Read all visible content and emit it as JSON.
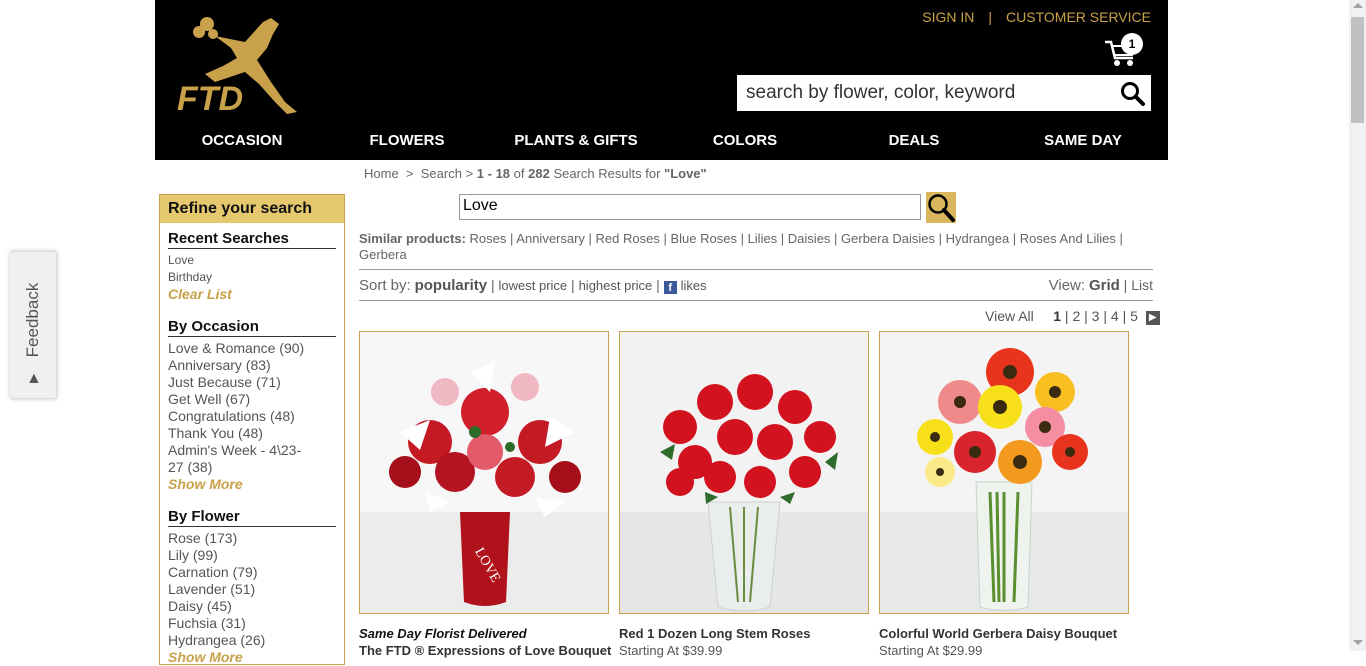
{
  "header": {
    "logo_text": "FTD",
    "sign_in": "SIGN IN",
    "separator": "|",
    "customer_service": "CUSTOMER SERVICE",
    "cart_count": "1",
    "search_placeholder": "search by flower, color, keyword",
    "nav": [
      "OCCASION",
      "FLOWERS",
      "PLANTS & GIFTS",
      "COLORS",
      "DEALS",
      "SAME DAY"
    ]
  },
  "feedback": {
    "label": "Feedback",
    "arrow": "▲"
  },
  "breadcrumb": {
    "home": "Home",
    "sep": ">",
    "search": "Search",
    "range": "1 - 18",
    "of": "of",
    "total": "282",
    "label": "Search Results for",
    "query": "\"Love\""
  },
  "sidebar": {
    "refine_title": "Refine your search",
    "recent": {
      "title": "Recent Searches",
      "items": [
        "Love",
        "Birthday"
      ],
      "clear": "Clear List"
    },
    "occasion": {
      "title": "By Occasion",
      "items": [
        "Love & Romance (90)",
        "Anniversary (83)",
        "Just Because (71)",
        "Get Well (67)",
        "Congratulations (48)",
        "Thank You (48)",
        "Admin's Week - 4\\23-",
        "27 (38)"
      ],
      "more": "Show More"
    },
    "flower": {
      "title": "By Flower",
      "items": [
        "Rose (173)",
        "Lily (99)",
        "Carnation (79)",
        "Lavender (51)",
        "Daisy (45)",
        "Fuchsia (31)",
        "Hydrangea (26)"
      ],
      "more": "Show More"
    }
  },
  "search": {
    "value": "Love"
  },
  "similar": {
    "label": "Similar products:",
    "items": [
      "Roses",
      "Anniversary",
      "Red Roses",
      "Blue Roses",
      "Lilies",
      "Daisies",
      "Gerbera Daisies",
      "Hydrangea",
      "Roses And Lilies",
      "Gerbera"
    ]
  },
  "sort": {
    "label": "Sort by:",
    "active": "popularity",
    "options": [
      "lowest price",
      "highest price",
      "likes"
    ],
    "fb_icon": "f",
    "view_label": "View:",
    "view_grid": "Grid",
    "view_list": "List"
  },
  "pager": {
    "view_all": "View All",
    "pages": [
      "1",
      "2",
      "3",
      "4",
      "5"
    ],
    "next": "▶"
  },
  "products": [
    {
      "tag": "Same Day Florist Delivered",
      "name": "The FTD ® Expressions of Love Bouquet",
      "vase_text": "LOVE"
    },
    {
      "name": "Red 1 Dozen Long Stem Roses",
      "price": "Starting At $39.99"
    },
    {
      "name": "Colorful World Gerbera Daisy Bouquet",
      "price": "Starting At $29.99"
    }
  ],
  "colors": {
    "accent": "#c9a14a",
    "header_bg": "#000000",
    "refine_bg": "#e6c96f"
  }
}
